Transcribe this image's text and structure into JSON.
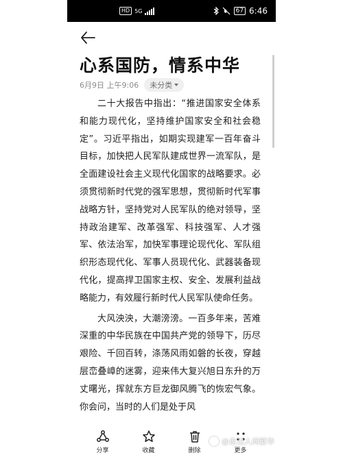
{
  "status_bar": {
    "hd": "HD",
    "network": "5G",
    "battery": "67",
    "time": "6:46",
    "icons": [
      "hd-icon",
      "signal-icon",
      "bluetooth-icon",
      "mute-icon",
      "battery-icon"
    ]
  },
  "header": {
    "back_icon": "arrow-left-icon"
  },
  "note": {
    "title": "心系国防，情系中华",
    "date": "6月9日 上午9:06",
    "category": "未分类",
    "paragraphs": [
      "二十大报告中指出：“推进国家安全体系和能力现代化，坚持维护国家安全和社会稳定”。习近平指出，如期实现建军一百年奋斗目标，加快把人民军队建成世界一流军队，是全面建设社会主义现代化国家的战略要求。必须贯彻新时代党的强军思想，贯彻新时代军事战略方针，坚持党对人民军队的绝对领导，坚持政治建军、改革强军、科技强军、人才强军、依法治军，加快军事理论现代化、军队组织形态现代化、军事人员现代化、武器装备现代化，提高捍卫国家主权、安全、发展利益战略能力，有效履行新时代人民军队使命任务。",
      "大风泱泱，大潮滂滂。一百多年来，苦难深重的中华民族在中国共产党的领导下，历尽艰险、千回百转，涤荡风雨如磐的长夜，穿越层峦叠嶂的迷雾，迎来伟大复兴旭日东升的万丈曙光，挥就东方巨龙御风腾飞的恢宏气象。你会问，当时的人们是处于风"
    ]
  },
  "bottom_bar": {
    "share": "分享",
    "favorite": "收藏",
    "delete": "删除",
    "more": "更多"
  },
  "watermark": {
    "text": "@走过人间繁华"
  },
  "colors": {
    "background": "#ffffff",
    "status_bar": "#000000",
    "text": "#222222",
    "meta": "#8a8a8a",
    "chip": "#f0f0f0"
  }
}
